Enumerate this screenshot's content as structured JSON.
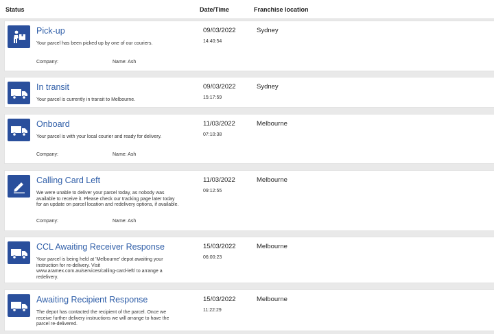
{
  "header": {
    "status": "Status",
    "datetime": "Date/Time",
    "location": "Franchise location"
  },
  "events": [
    {
      "icon": "pickup-icon",
      "title": "Pick-up",
      "description": "Your parcel has been picked up by one of our couriers.",
      "date": "09/03/2022",
      "time": "14:40:54",
      "location": "Sydney",
      "company_label": "Company:",
      "name_label": "Name: Ash"
    },
    {
      "icon": "truck-icon",
      "title": "In transit",
      "description": "Your parcel is currently in transit to Melbourne.",
      "date": "09/03/2022",
      "time": "15:17:59",
      "location": "Sydney"
    },
    {
      "icon": "truck-icon",
      "title": "Onboard",
      "description": "Your parcel is with your local courier and ready for delivery.",
      "date": "11/03/2022",
      "time": "07:10:38",
      "location": "Melbourne",
      "company_label": "Company:",
      "name_label": "Name: Ash"
    },
    {
      "icon": "pencil-icon",
      "title": "Calling Card Left",
      "description": "We were unable to deliver your parcel today, as nobody was available to receive it. Please check our tracking page later today for an update on parcel location and redelivery options, if available.",
      "date": "11/03/2022",
      "time": "09:12:55",
      "location": "Melbourne",
      "company_label": "Company:",
      "name_label": "Name: Ash"
    },
    {
      "icon": "truck-icon",
      "title": "CCL Awaiting Receiver Response",
      "description": "Your parcel is being held at 'Melbourne' depot awaiting your instruction for re-delivery. Visit www.aramex.com.au/services/calling-card-left/ to arrange a redelivery.",
      "date": "15/03/2022",
      "time": "06:00:23",
      "location": "Melbourne"
    },
    {
      "icon": "truck-icon",
      "title": "Awaiting Recipient Response",
      "description": "The depot has contacted the recipient of the parcel. Once we receive further delivery instructions we will arrange to have the parcel re-delivered.",
      "date": "15/03/2022",
      "time": "11:22:29",
      "location": "Melbourne"
    }
  ]
}
